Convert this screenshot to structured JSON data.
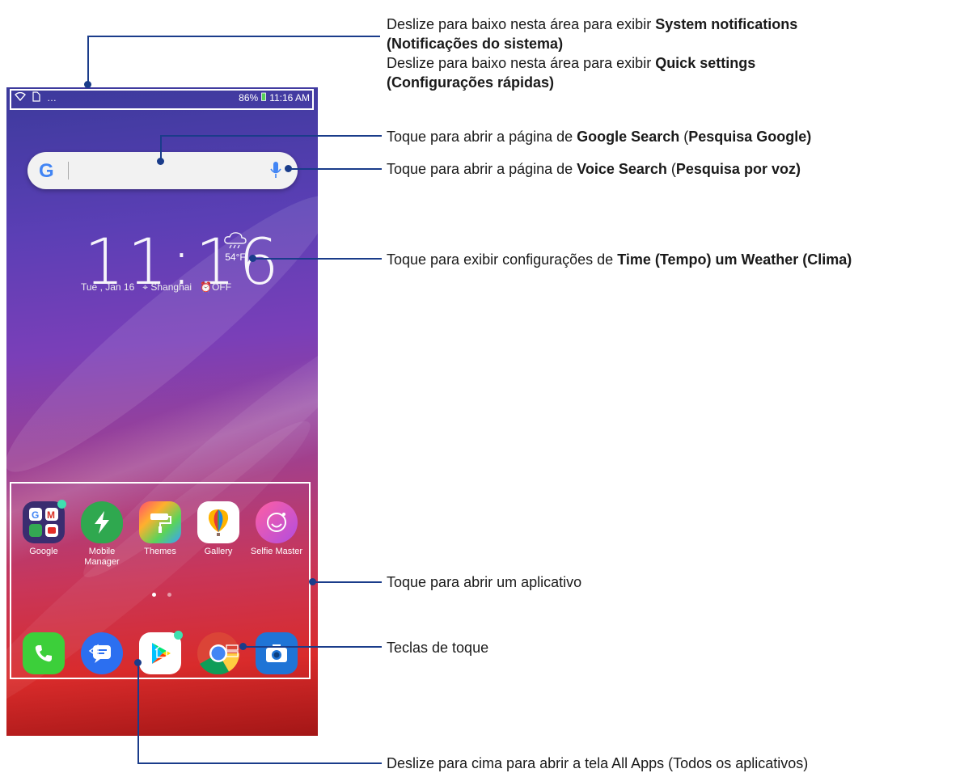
{
  "status_bar": {
    "battery": "86%",
    "time": "11:16 AM"
  },
  "search": {
    "logo": "G",
    "icon_google": "google-g-icon",
    "icon_mic": "microphone-icon"
  },
  "clock_widget": {
    "time": "11:16",
    "temperature": "54°F",
    "date": "Tue , Jan 16",
    "location": "Shanghai",
    "alarm": "OFF"
  },
  "apps": [
    {
      "label": "Google"
    },
    {
      "label": "Mobile Manager"
    },
    {
      "label": "Themes"
    },
    {
      "label": "Gallery"
    },
    {
      "label": "Selfie Master"
    }
  ],
  "dock": [
    "phone",
    "messages",
    "play-store",
    "chrome",
    "camera"
  ],
  "annotations": {
    "notif_pre": "Deslize para baixo nesta área para exibir ",
    "notif_bold": "System notifications",
    "notif_bold2": "(Notificações do sistema)",
    "quick_pre": "Deslize para baixo nesta área para exibir ",
    "quick_bold": "Quick settings",
    "quick_bold2": "(Configurações rápidas)",
    "google_pre": "Toque para abrir a página de ",
    "google_bold": "Google Search",
    "google_mid": " (",
    "google_bold2": "Pesquisa Google)",
    "voice_pre": "Toque para abrir a página de ",
    "voice_bold": "Voice Search",
    "voice_mid": " (",
    "voice_bold2": "Pesquisa por voz)",
    "time_pre": "Toque para exibir configurações de ",
    "time_bold": "Time (Tempo) um Weather (Clima)",
    "app": "Toque para abrir um aplicativo",
    "keys": "Teclas de toque",
    "allapps": "Deslize para cima para abrir a tela All Apps (Todos os aplicativos)"
  }
}
